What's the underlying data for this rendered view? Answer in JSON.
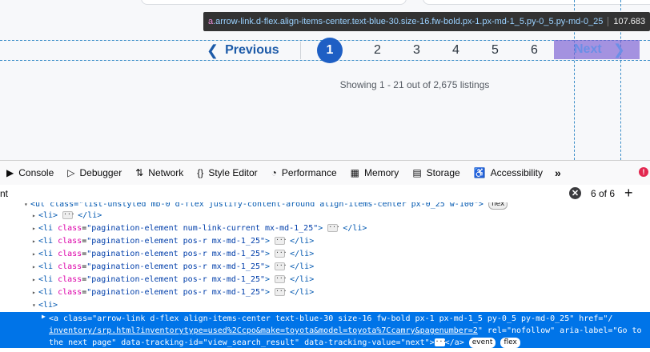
{
  "page": {
    "tooltip": {
      "tag": "a",
      "classes": ".arrow-link.d-flex.align-items-center.text-blue-30.size-16.fw-bold.px-1.px-md-1_5.py-0_5.py-md-0_25",
      "dimensions": "107.683"
    },
    "pagination": {
      "previous_label": "Previous",
      "previous_chevron": "❮",
      "current_page": "1",
      "pages": [
        "2",
        "3",
        "4",
        "5",
        "6"
      ],
      "next_label": "Next",
      "next_chevron": "❯"
    },
    "showing_text": "Showing 1 - 21 out of 2,675 listings"
  },
  "devtools": {
    "tabs": [
      {
        "label": "Console",
        "icon": "console-icon"
      },
      {
        "label": "Debugger",
        "icon": "debugger-icon"
      },
      {
        "label": "Network",
        "icon": "network-icon"
      },
      {
        "label": "Style Editor",
        "icon": "style-editor-icon"
      },
      {
        "label": "Performance",
        "icon": "performance-icon"
      },
      {
        "label": "Memory",
        "icon": "memory-icon"
      },
      {
        "label": "Storage",
        "icon": "storage-icon"
      },
      {
        "label": "Accessibility",
        "icon": "accessibility-icon"
      }
    ],
    "overflow": "»",
    "error_mark": "!",
    "search": {
      "value": "nt",
      "clear": "✕",
      "match_count": "6 of 6",
      "add": "+"
    },
    "tree": {
      "ul_partial": "<ul class=\"list-unstyled mb-0 d-flex justify-content-around align-items-center px-0_25 w-100\">",
      "ul_badge": "flex",
      "li_open": "<li>",
      "li_close": "</li>",
      "rows": [
        {
          "open": "<li>",
          "cls": "",
          "close": "</li>"
        },
        {
          "open": "<li ",
          "cls": "pagination-element num-link-current mx-md-1_25",
          "close": "</li>"
        },
        {
          "open": "<li ",
          "cls": "pagination-element pos-r mx-md-1_25",
          "close": "</li>"
        },
        {
          "open": "<li ",
          "cls": "pagination-element pos-r mx-md-1_25",
          "close": "</li>"
        },
        {
          "open": "<li ",
          "cls": "pagination-element pos-r mx-md-1_25",
          "close": "</li>"
        },
        {
          "open": "<li ",
          "cls": "pagination-element pos-r mx-md-1_25",
          "close": "</li>"
        },
        {
          "open": "<li ",
          "cls": "pagination-element pos-r mx-md-1_25",
          "close": "</li>"
        }
      ],
      "selected": {
        "line1": "<a class=\"arrow-link d-flex align-items-center text-blue-30 size-16 fw-bold px-1 px-md-1_5 py-0_5 py-md-0_25\" href=\"/",
        "line2_link": "inventory/srp.html?inventorytype=used%2Ccpo&make=toyota&model=toyota%7Ccamry&pagenumber=2",
        "line2_rest": "\" rel=\"nofollow\" aria-label=\"Go to",
        "line3": "the next page\" data-tracking-id=\"view_search_result\" data-tracking-value=\"next\">",
        "line3_close": "</a>",
        "badge_event": "event",
        "badge_flex": "flex"
      }
    }
  }
}
